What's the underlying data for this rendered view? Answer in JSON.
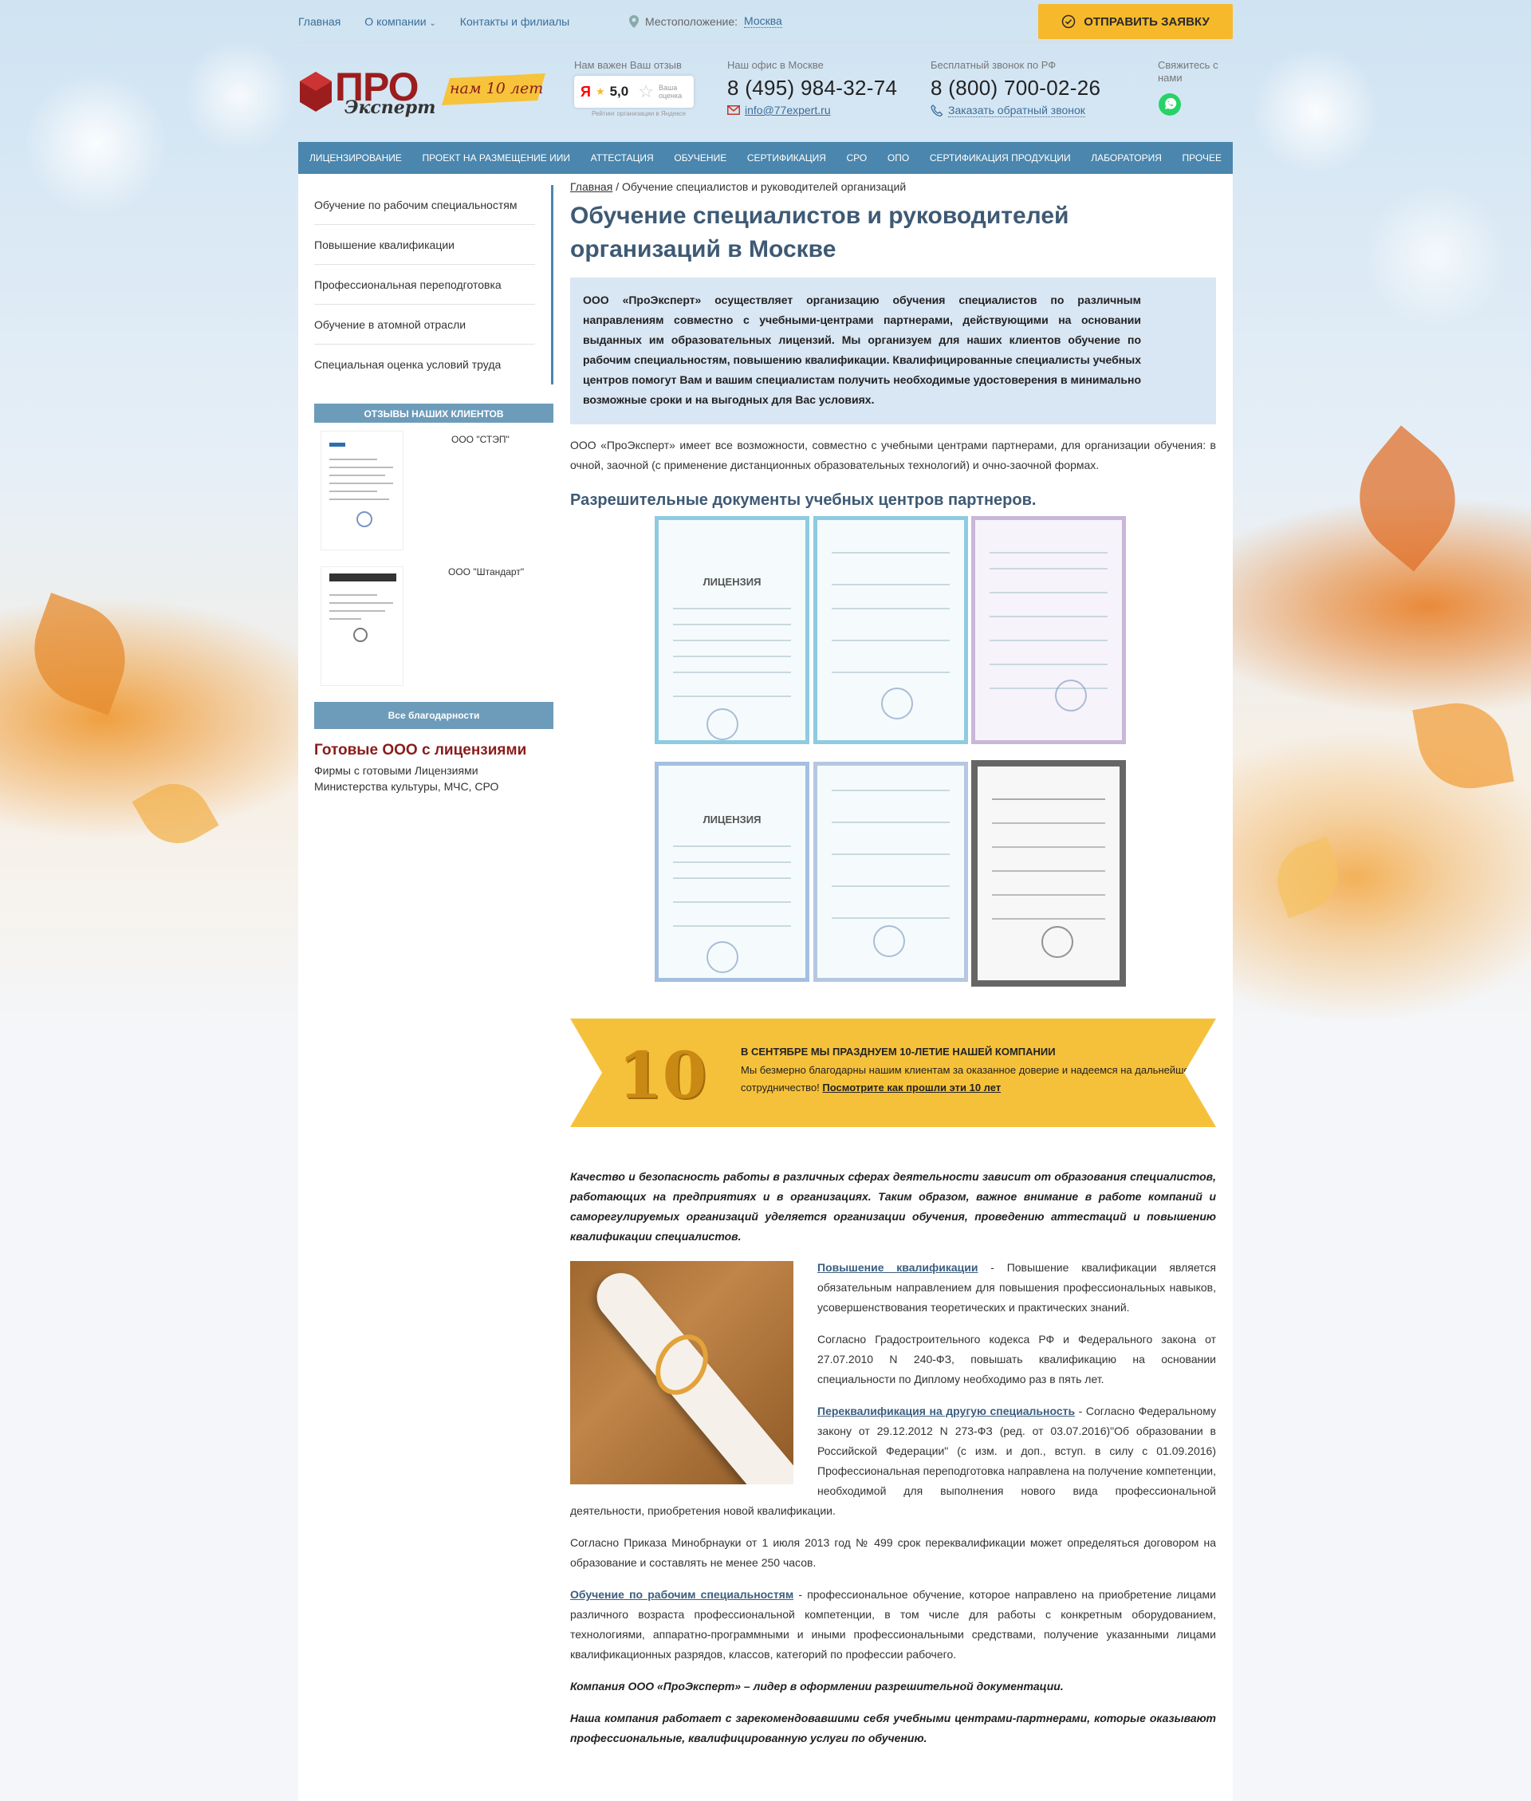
{
  "topbar": {
    "links": [
      "Главная",
      "О компании",
      "Контакты и филиалы"
    ],
    "location_label": "Местоположение:",
    "location_city": "Москва",
    "send_button": "ОТПРАВИТЬ ЗАЯВКУ"
  },
  "header": {
    "logo_text": "ПРО",
    "logo_subtext": "Эксперт",
    "logo_badge": "нам 10 лет",
    "rating_label": "Нам важен Ваш отзыв",
    "rating_value": "5,0",
    "rating_mark": "Ваша оценка",
    "rating_caption": "Рейтинг организации в Яндексе",
    "office_label": "Наш офис в Москве",
    "office_phone": "8 (495) 984-32-74",
    "email": "info@77expert.ru",
    "free_label": "Бесплатный звонок по РФ",
    "free_phone": "8 (800) 700-02-26",
    "callback": "Заказать обратный звонок",
    "contact_label": "Свяжитесь с нами"
  },
  "nav": [
    "ЛИЦЕНЗИРОВАНИЕ",
    "ПРОЕКТ НА РАЗМЕЩЕНИЕ ИИИ",
    "АТТЕСТАЦИЯ",
    "ОБУЧЕНИЕ",
    "СЕРТИФИКАЦИЯ",
    "СРО",
    "ОПО",
    "СЕРТИФИКАЦИЯ ПРОДУКЦИИ",
    "ЛАБОРАТОРИЯ",
    "ПРОЧЕЕ"
  ],
  "sidebar": {
    "items": [
      "Обучение по рабочим специальностям",
      "Повышение квалификации",
      "Профессиональная переподготовка",
      "Обучение в атомной отрасли",
      "Специальная оценка условий труда"
    ],
    "reviews_title": "ОТЗЫВЫ НАШИХ КЛИЕНТОВ",
    "reviews": [
      "ООО \"СТЭП\"",
      "ООО \"Штандарт\""
    ],
    "all_button": "Все благодарности",
    "ready_title": "Готовые ООО с лицензиями",
    "ready_text": "Фирмы с готовыми Лицензиями Министерства культуры, МЧС, СРО"
  },
  "main": {
    "crumb_home": "Главная",
    "crumb_current": "/ Обучение специалистов и руководителей организаций",
    "title": "Обучение специалистов и руководителей организаций в Москве",
    "lead": "ООО «ПроЭксперт» осуществляет организацию обучения специалистов по различным направлениям совместно с учебными-центрами партнерами, действующими на основании выданных им образовательных лицензий. Мы организуем для наших клиентов обучение по рабочим специальностям, повышению квалификации. Квалифицированные специалисты учебных центров помогут Вам и вашим специалистам получить необходимые удостоверения в минимально возможные сроки и на выгодных для Вас условиях.",
    "para1": "ООО «ПроЭксперт» имеет все возможности, совместно с учебными центрами партнерами, для организации обучения: в очной, заочной (с применение дистанционных образовательных технологий) и очно-заочной формах.",
    "docs_title": "Разрешительные документы учебных центров партнеров.",
    "cert_label": "ЛИЦЕНЗИЯ",
    "banner_num": "10",
    "banner_title": "В СЕНТЯБРЕ МЫ ПРАЗДНУЕМ 10-ЛЕТИЕ НАШЕЙ КОМПАНИИ",
    "banner_text": "Мы безмерно благодарны нашим клиентам за оказанное доверие и надеемся на дальнейшее сотрудничество!",
    "banner_link": "Посмотрите как прошли эти 10 лет",
    "italic1": "Качество и безопасность работы в различных сферах деятельности зависит от образования специалистов, работающих на предприятиях и в организациях. Таким образом, важное внимание в работе компаний и саморегулируемых организаций уделяется организации обучения, проведению аттестаций и повышению квалификации специалистов.",
    "qual_link": "Повышение квалификации",
    "qual_text": " - Повышение квалификации является обязательным направлением для повышения профессиональных навыков, усовершенствования теоретических и практических знаний.",
    "qual_law": "Согласно Градостроительного кодекса РФ и Федерального закона от 27.07.2010 N 240-ФЗ, повышать квалификацию на основании специальности по Диплому необходимо раз в пять лет.",
    "requal_link": "Переквалификация на другую специальность",
    "requal_text": " - Согласно Федеральному закону от 29.12.2012 N 273-ФЗ (ред. от 03.07.2016)\"Об образовании в Российской Федерации\" (с изм. и доп., вступ. в силу с 01.09.2016) Профессиональная переподготовка направлена на получение компетенции, необходимой для выполнения нового вида профессиональной деятельности, приобретения новой квалификации.",
    "order_text": "Согласно Приказа Минобрнауки от 1 июля 2013 год № 499 срок переквалификации может определяться договором на образование и составлять не менее 250 часов.",
    "work_link": "Обучение по рабочим специальностям",
    "work_text": " - профессиональное обучение, которое направлено на приобретение лицами различного возраста профессиональной компетенции, в том числе для работы с конкретным оборудованием, технологиями, аппаратно-программными и иными профессиональными средствами, получение указанными лицами квалификационных разрядов, классов, категорий по профессии рабочего.",
    "italic2": "Компания ООО «ПроЭксперт» – лидер в оформлении разрешительной документации.",
    "italic3": "Наша компания работает с зарекомендовавшими себя учебными центрами-партнерами, которые оказывают профессиональные, квалифицированную услуги по обучению."
  },
  "colors": {
    "accent": "#4a86ad",
    "button": "#f7b92c",
    "title": "#3e5a74",
    "lead_bg": "#d9e6f4"
  }
}
